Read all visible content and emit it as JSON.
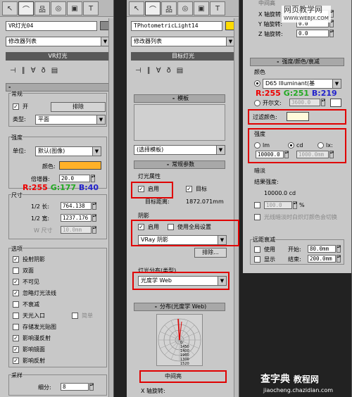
{
  "colors": {
    "accent_red": "#e00000",
    "swatch_orange": "#ffb128",
    "swatch_yellow": "#ffdb00",
    "filter_color": "#fffbdb"
  },
  "p1": {
    "tabs": [
      "cursor-icon",
      "curve-icon",
      "hierarchy-icon",
      "motion-icon",
      "display-icon",
      "hammer-icon"
    ],
    "object_name": "VR灯光04",
    "modifier_list": "修改器列表",
    "stack_item": "VR灯光",
    "rollout_general": "常规",
    "on_label": "开",
    "exclude_btn": "排除",
    "type_label": "类型:",
    "type_value": "平面",
    "intensity_title": "强度",
    "units_label": "单位:",
    "units_value": "默认(图像)",
    "color_label": "颜色:",
    "multiplier_label": "倍增器:",
    "multiplier_value": "20.0",
    "rgb": {
      "r": "R:255",
      "g": "G:177",
      "b": "B:40"
    },
    "size_title": "尺寸",
    "half_len_label": "1/2 长:",
    "half_len_value": "764.138",
    "half_wid_label": "1/2 宽:",
    "half_wid_value": "1237.176",
    "w_size_label": "W 尺寸",
    "w_size_value": "10.0mm",
    "options_title": "选项",
    "options": [
      {
        "label": "投射阴影",
        "checked": true
      },
      {
        "label": "双面",
        "checked": false
      },
      {
        "label": "不可见",
        "checked": true
      },
      {
        "label": "忽略灯光法线",
        "checked": true
      },
      {
        "label": "不衰减",
        "checked": false
      },
      {
        "label": "天光入口",
        "checked": false
      },
      {
        "label": "存储发光贴图",
        "checked": false
      },
      {
        "label": "影响漫反射",
        "checked": true
      },
      {
        "label": "影响镜面",
        "checked": true
      },
      {
        "label": "影响反射",
        "checked": true
      }
    ],
    "simple_label": "简单",
    "sampling_title": "采样",
    "subdivs_label": "细分:",
    "subdivs_value": "8"
  },
  "p2": {
    "object_name": "TPhotometricLight14",
    "modifier_list": "修改器列表",
    "stack_item": "目标灯光",
    "rollout_template": "模板",
    "template_select": "(选择模板)",
    "rollout_general": "常规参数",
    "light_props": "灯光属性",
    "enable_label": "启用",
    "target_label": "目标",
    "target_dist_label": "目标距离:",
    "target_dist_value": "1872.071mm",
    "shadow_title": "阴影",
    "shadow_enable": "启用",
    "global_label": "使用全局设置",
    "shadow_type": "VRay 阴影",
    "exclude_btn": "排除...",
    "dist_title": "灯光分布(类型)",
    "dist_value": "光度学 Web",
    "rollout_dist": "分布(光度学 Web)",
    "web_labels": [
      "0",
      "1450",
      "1400",
      "1900",
      "1300",
      "1520"
    ],
    "caption": "中间亮",
    "rotate_label": "X 轴旋转:"
  },
  "p3": {
    "header_partial": "中间高",
    "x_rot": "X 轴旋转:",
    "y_rot": "Y 轴旋转:",
    "z_rot": "Z 轴旋转:",
    "rot_value": "0.0",
    "rollout_title": "强度/颜色/衰减",
    "color_title": "颜色",
    "d65_value": "D65 Illuminant(基",
    "kelvin_label": "开尔文:",
    "kelvin_value": "3600.0",
    "rgb": {
      "r": "R:255",
      "g": "G:251",
      "b": "B:219"
    },
    "filter_label": "过滤颜色:",
    "intensity_title": "强度",
    "lm": "lm",
    "cd": "cd",
    "lx": "lx:",
    "intensity_value": "10000.0",
    "lx_value": "1000.0mm",
    "dimming_title": "暗淡",
    "result_label": "结果强度:",
    "result_value": "10000.0 cd",
    "percent_value": "100.0",
    "percent_sign": "%",
    "incandescent": "光线暗淡时白炽灯颜色会切换",
    "far_title": "远距衰减",
    "use_label": "使用",
    "show_label": "显示",
    "start_label": "开始:",
    "start_value": "80.0mm",
    "end_label": "结束:",
    "end_value": "200.0mm"
  },
  "watermark": {
    "top_site": "网页教学网",
    "top_url": "WWW.WEBJX.COM",
    "bottom_brand": "查字典",
    "bottom_sub": "教程网",
    "bottom_url": "jiaocheng.chazidian.com"
  }
}
